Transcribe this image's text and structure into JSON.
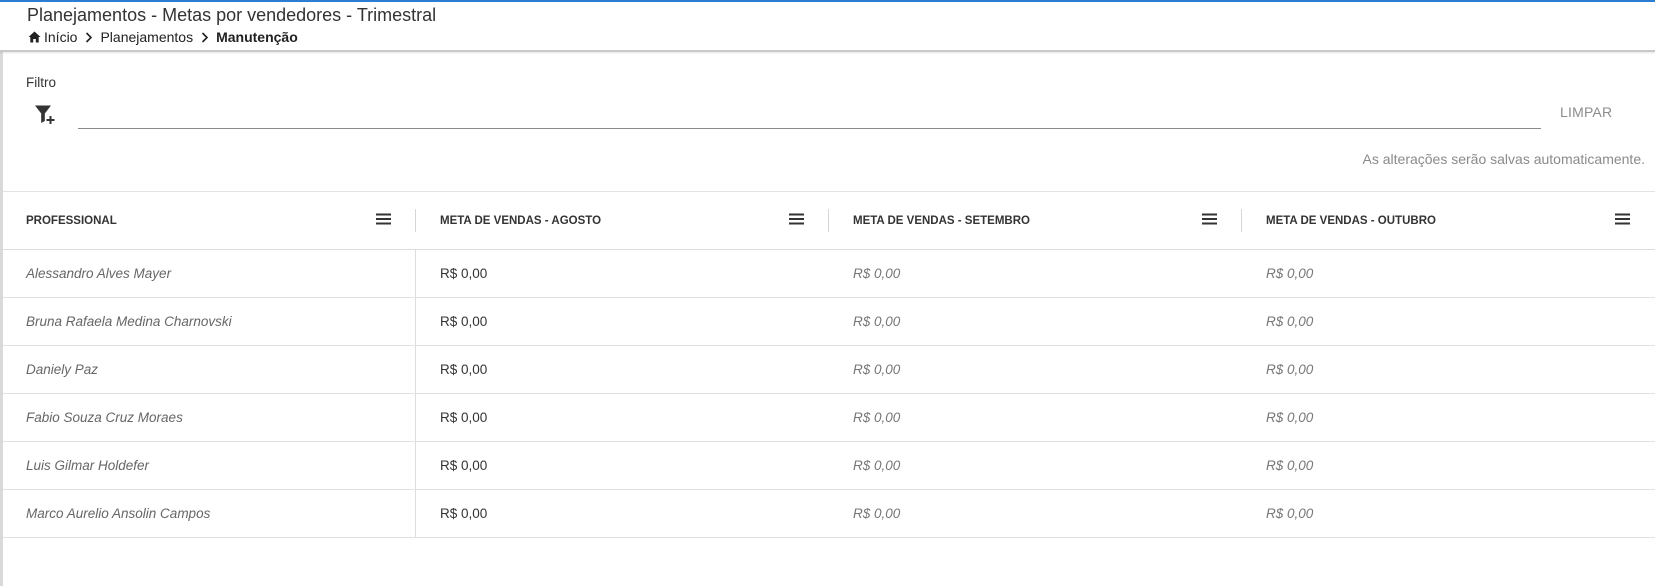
{
  "header": {
    "title": "Planejamentos - Metas por vendedores - Trimestral",
    "breadcrumb": {
      "home": "Início",
      "planning": "Planejamentos",
      "current": "Manutenção"
    }
  },
  "filter": {
    "label": "Filtro",
    "value": "",
    "clear_label": "LIMPAR"
  },
  "autosave_note": "As alterações serão salvas automaticamente.",
  "grid": {
    "columns": [
      "PROFESSIONAL",
      "META DE VENDAS - AGOSTO",
      "META DE VENDAS - SETEMBRO",
      "META DE VENDAS - OUTUBRO"
    ],
    "rows": [
      {
        "professional": "Alessandro Alves Mayer",
        "agosto": "R$ 0,00",
        "setembro": "R$ 0,00",
        "outubro": "R$ 0,00"
      },
      {
        "professional": "Bruna Rafaela Medina Charnovski",
        "agosto": "R$ 0,00",
        "setembro": "R$ 0,00",
        "outubro": "R$ 0,00"
      },
      {
        "professional": "Daniely Paz",
        "agosto": "R$ 0,00",
        "setembro": "R$ 0,00",
        "outubro": "R$ 0,00"
      },
      {
        "professional": "Fabio Souza Cruz Moraes",
        "agosto": "R$ 0,00",
        "setembro": "R$ 0,00",
        "outubro": "R$ 0,00"
      },
      {
        "professional": "Luis Gilmar Holdefer",
        "agosto": "R$ 0,00",
        "setembro": "R$ 0,00",
        "outubro": "R$ 0,00"
      },
      {
        "professional": "Marco Aurelio Ansolin Campos",
        "agosto": "R$ 0,00",
        "setembro": "R$ 0,00",
        "outubro": "R$ 0,00"
      }
    ]
  },
  "icons": {
    "home": "home-icon",
    "breadcrumb_separator": "chevron-right-icon",
    "filter_add": "filter-add-icon",
    "column_menu": "menu-icon"
  },
  "colors": {
    "accent_top_border": "#2b7cd3",
    "muted_text": "#8a8a8a"
  }
}
